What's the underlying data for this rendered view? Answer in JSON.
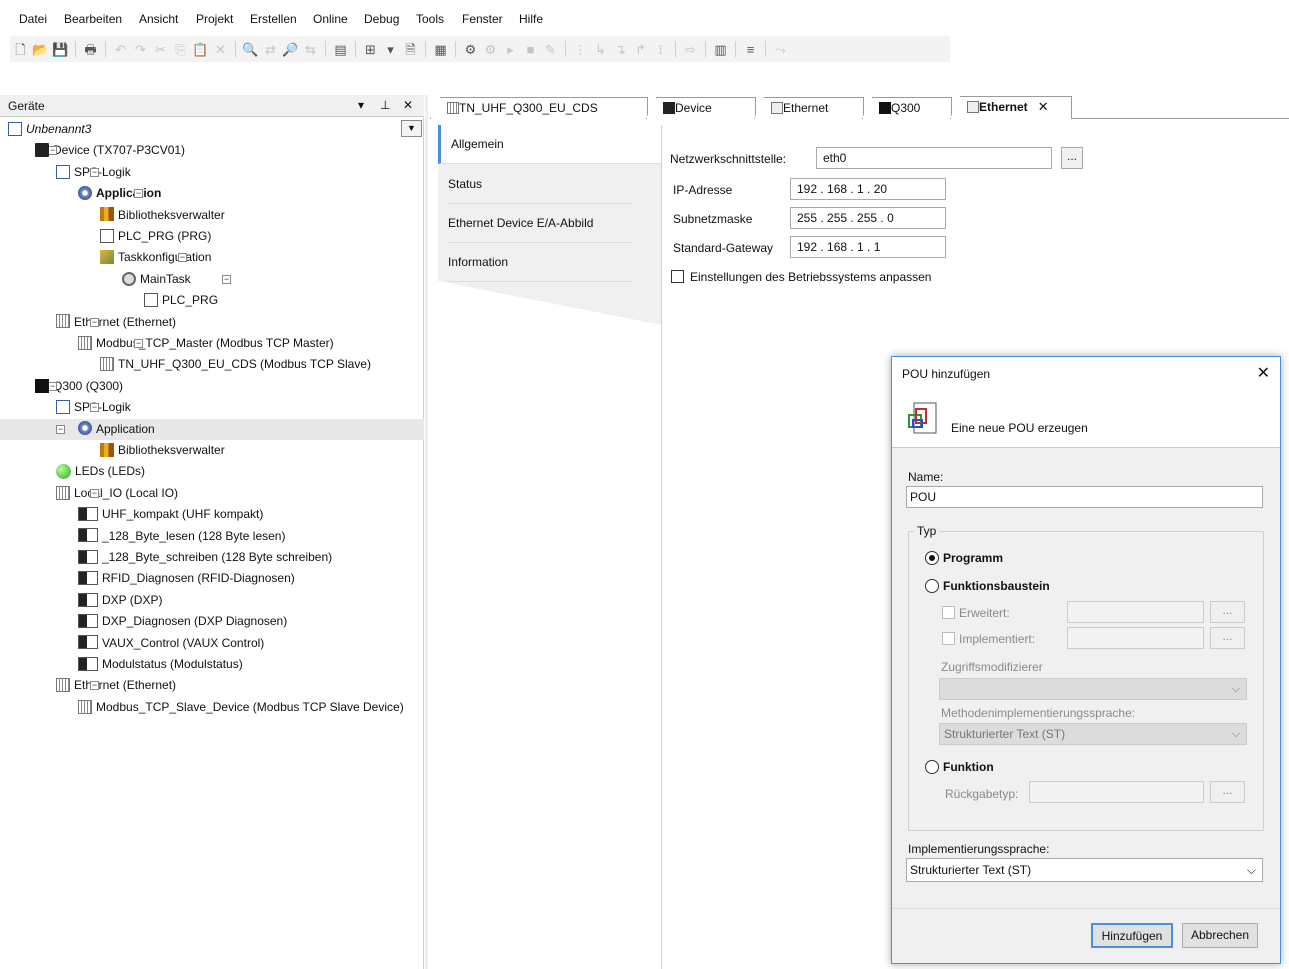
{
  "menu": [
    "Datei",
    "Bearbeiten",
    "Ansicht",
    "Projekt",
    "Erstellen",
    "Online",
    "Debug",
    "Tools",
    "Fenster",
    "Hilfe"
  ],
  "devices_panel": {
    "title": "Geräte",
    "pin": "▾ ⊤ ✕",
    "tree": [
      {
        "label": "Unbenannt3",
        "italic": true
      },
      {
        "label": "Device (TX707-P3CV01)"
      },
      {
        "label": "SPS-Logik"
      },
      {
        "label": "Application",
        "bold": true
      },
      {
        "label": "Bibliotheksverwalter"
      },
      {
        "label": "PLC_PRG (PRG)"
      },
      {
        "label": "Taskkonfiguration"
      },
      {
        "label": "MainTask"
      },
      {
        "label": "PLC_PRG"
      },
      {
        "label": "Ethernet (Ethernet)"
      },
      {
        "label": "Modbus_TCP_Master (Modbus TCP Master)"
      },
      {
        "label": "TN_UHF_Q300_EU_CDS (Modbus TCP Slave)"
      },
      {
        "label": "Q300 (Q300)"
      },
      {
        "label": "SPS-Logik"
      },
      {
        "label": "Application",
        "selected": true
      },
      {
        "label": "Bibliotheksverwalter"
      },
      {
        "label": "LEDs (LEDs)"
      },
      {
        "label": "Local_IO (Local IO)"
      },
      {
        "label": "UHF_kompakt (UHF kompakt)"
      },
      {
        "label": "_128_Byte_lesen (128 Byte lesen)"
      },
      {
        "label": "_128_Byte_schreiben (128 Byte schreiben)"
      },
      {
        "label": "RFID_Diagnosen (RFID-Diagnosen)"
      },
      {
        "label": "DXP (DXP)"
      },
      {
        "label": "DXP_Diagnosen (DXP Diagnosen)"
      },
      {
        "label": "VAUX_Control (VAUX Control)"
      },
      {
        "label": "Modulstatus (Modulstatus)"
      },
      {
        "label": "Ethernet (Ethernet)"
      },
      {
        "label": "Modbus_TCP_Slave_Device (Modbus TCP Slave Device)"
      }
    ]
  },
  "editor_tabs": [
    "TN_UHF_Q300_EU_CDS",
    "Device",
    "Ethernet",
    "Q300",
    "Ethernet"
  ],
  "sub_tabs": [
    "Allgemein",
    "Status",
    "Ethernet Device E/A-Abbild",
    "Information"
  ],
  "ethernet_form": {
    "interface_label": "Netzwerkschnittstelle:",
    "interface_value": "eth0",
    "browse": "...",
    "ip_label": "IP-Adresse",
    "ip_value": "192 . 168 . 1 . 20",
    "mask_label": "Subnetzmaske",
    "mask_value": "255 . 255 . 255 . 0",
    "gw_label": "Standard-Gateway",
    "gw_value": "192 . 168 . 1 . 1",
    "os_checkbox": "Einstellungen des Betriebssystems anpassen"
  },
  "dialog": {
    "title": "POU hinzufügen",
    "close": "✕",
    "header": "Eine neue POU erzeugen",
    "name_label": "Name:",
    "name_value": "POU",
    "group": "Typ",
    "programm": "Programm",
    "funktionsbaustein": "Funktionsbaustein",
    "erweitert": "Erweitert:",
    "implementiert": "Implementiert:",
    "dots": "...",
    "zugriff": "Zugriffsmodifizierer",
    "methoden": "Methodenimplementierungssprache:",
    "methoden_value": "Strukturierter Text (ST)",
    "funktion": "Funktion",
    "rueckgabe": "Rückgabetyp:",
    "impl_label": "Implementierungssprache:",
    "impl_value": "Strukturierter Text (ST)",
    "add": "Hinzufügen",
    "cancel": "Abbrechen"
  }
}
